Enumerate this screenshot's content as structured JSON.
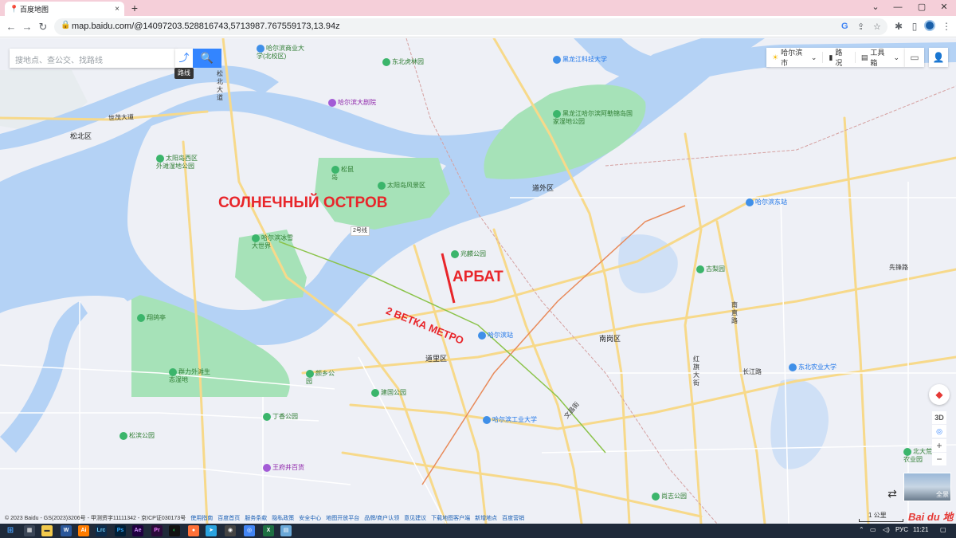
{
  "browser": {
    "tab_title": "百度地图",
    "tab_close": "×",
    "new_tab": "+",
    "url": "map.baidu.com/@14097203.528816743,5713987.767559173,13.94z",
    "win_min": "—",
    "win_max": "▢",
    "win_close": "✕",
    "caret": "⌄"
  },
  "map_ui": {
    "search_placeholder": "搜地点、查公交、找路线",
    "route_tooltip": "路线",
    "city": "哈尔滨市",
    "traffic": "路况",
    "toolbox": "工具箱",
    "btn_3d": "3D",
    "zoom_in": "+",
    "zoom_out": "−",
    "streetview_label": "全景",
    "scale": "1 公里",
    "logo": "Bai du 地图"
  },
  "overlay_text": {
    "island": "СОЛНЕЧНЫЙ ОСТРОВ",
    "arbat": "АРБАТ",
    "metro": "2 ВЕТКА МЕТРО"
  },
  "districts": {
    "songbei": "松北区",
    "daowai": "道外区",
    "daoli": "道里区",
    "nangang": "南岗区"
  },
  "roads": {
    "shimao": "世茂大道",
    "songbei_ave": "松北大道",
    "xianfeng": "先锋路",
    "nanzhi": "南直路",
    "changjiang": "长江路",
    "hongqi": "红旗大街",
    "wenchang": "文昌街",
    "line2": "2号线"
  },
  "pois": {
    "p1": "哈尔滨商业大学(北校区)",
    "p2": "东北虎林园",
    "p3": "黑龙江科技大学",
    "p4": "哈尔滨大剧院",
    "p5": "黑龙江哈尔滨阿勒锦岛国家湿地公园",
    "p6": "太阳岛西区外滩湿地公园",
    "p7": "松鼠岛",
    "p8": "太阳岛风景区",
    "p9": "哈尔滨东站",
    "p10": "哈尔滨冰雪大世界",
    "p11": "兆麟公园",
    "p12": "古梨园",
    "p13": "翔鸽亭",
    "p14": "哈尔滨站",
    "p15": "东北农业大学",
    "p16": "群力外滩生态湿地",
    "p17": "颜乡公园",
    "p18": "建国公园",
    "p19": "哈尔滨工业大学",
    "p20": "丁香公园",
    "p21": "松滨公园",
    "p22": "王府井百货",
    "p23": "尚志公园",
    "p24": "北大荒农业园"
  },
  "footer": {
    "copyright": "© 2023 Baidu - GS(2023)3206号 - 甲测资字11111342 - 京ICP证030173号",
    "links": [
      "使用指南",
      "百度首页",
      "服务条款",
      "隐私政策",
      "安全中心",
      "地图开放平台",
      "品牌/商户认领",
      "意见建议",
      "下载地图客户端",
      "新增地点",
      "百度营销"
    ]
  },
  "taskbar": {
    "lang": "РУС",
    "time": "11:21"
  }
}
